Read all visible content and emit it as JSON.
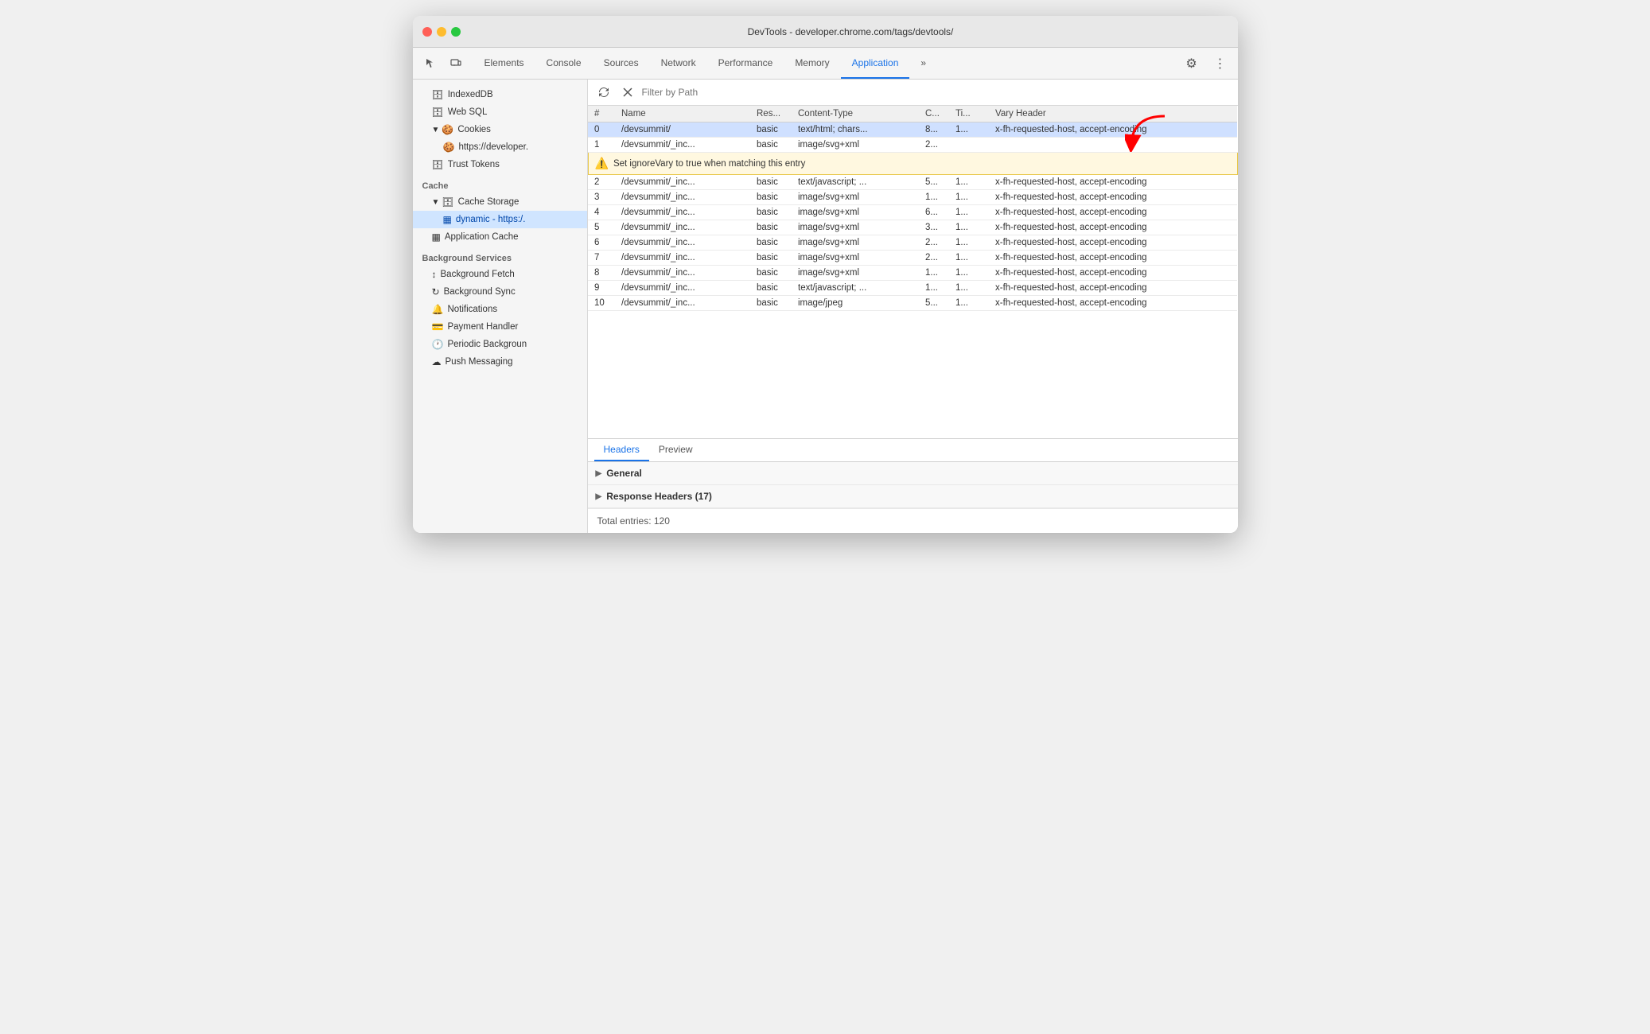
{
  "window": {
    "title": "DevTools - developer.chrome.com/tags/devtools/"
  },
  "toolbar": {
    "tabs": [
      {
        "id": "elements",
        "label": "Elements",
        "active": false
      },
      {
        "id": "console",
        "label": "Console",
        "active": false
      },
      {
        "id": "sources",
        "label": "Sources",
        "active": false
      },
      {
        "id": "network",
        "label": "Network",
        "active": false
      },
      {
        "id": "performance",
        "label": "Performance",
        "active": false
      },
      {
        "id": "memory",
        "label": "Memory",
        "active": false
      },
      {
        "id": "application",
        "label": "Application",
        "active": true
      }
    ],
    "more_label": "»",
    "settings_icon": "⚙",
    "menu_icon": "⋮"
  },
  "sidebar": {
    "sections": [
      {
        "items": [
          {
            "label": "IndexedDB",
            "icon": "🗄",
            "indent": 1,
            "expanded": false
          },
          {
            "label": "Web SQL",
            "icon": "🗄",
            "indent": 1,
            "expanded": false
          },
          {
            "label": "Cookies",
            "icon": "🍪",
            "indent": 1,
            "expanded": true,
            "hasTriangle": true
          },
          {
            "label": "https://developer.",
            "icon": "🍪",
            "indent": 2
          },
          {
            "label": "Trust Tokens",
            "icon": "🗄",
            "indent": 1
          }
        ]
      },
      {
        "name": "Cache",
        "items": [
          {
            "label": "Cache Storage",
            "icon": "🗄",
            "indent": 1,
            "expanded": true,
            "hasTriangle": true
          },
          {
            "label": "dynamic - https:/.",
            "icon": "▦",
            "indent": 2,
            "selected": true
          },
          {
            "label": "Application Cache",
            "icon": "▦",
            "indent": 1
          }
        ]
      },
      {
        "name": "Background Services",
        "items": [
          {
            "label": "Background Fetch",
            "icon": "↕",
            "indent": 1
          },
          {
            "label": "Background Sync",
            "icon": "↻",
            "indent": 1
          },
          {
            "label": "Notifications",
            "icon": "🔔",
            "indent": 1
          },
          {
            "label": "Payment Handler",
            "icon": "💳",
            "indent": 1
          },
          {
            "label": "Periodic Backgroun",
            "icon": "🕐",
            "indent": 1
          },
          {
            "label": "Push Messaging",
            "icon": "☁",
            "indent": 1
          }
        ]
      }
    ]
  },
  "filter": {
    "placeholder": "Filter by Path",
    "refresh_title": "Refresh",
    "clear_title": "Clear"
  },
  "table": {
    "columns": [
      "#",
      "Name",
      "Res...",
      "Content-Type",
      "C...",
      "Ti...",
      "Vary Header"
    ],
    "rows": [
      {
        "num": "0",
        "name": "/devsummit/",
        "res": "basic",
        "ct": "text/html; chars...",
        "c": "8...",
        "ti": "1...",
        "vary": "x-fh-requested-host, accept-encoding",
        "selected": true
      },
      {
        "num": "1",
        "name": "/devsummit/_inc...",
        "res": "basic",
        "ct": "image/svg+xml",
        "c": "2...",
        "ti": "",
        "vary": "",
        "tooltip": true
      },
      {
        "num": "2",
        "name": "/devsummit/_inc...",
        "res": "basic",
        "ct": "text/javascript; ...",
        "c": "5...",
        "ti": "1...",
        "vary": "x-fh-requested-host, accept-encoding"
      },
      {
        "num": "3",
        "name": "/devsummit/_inc...",
        "res": "basic",
        "ct": "image/svg+xml",
        "c": "1...",
        "ti": "1...",
        "vary": "x-fh-requested-host, accept-encoding"
      },
      {
        "num": "4",
        "name": "/devsummit/_inc...",
        "res": "basic",
        "ct": "image/svg+xml",
        "c": "6...",
        "ti": "1...",
        "vary": "x-fh-requested-host, accept-encoding"
      },
      {
        "num": "5",
        "name": "/devsummit/_inc...",
        "res": "basic",
        "ct": "image/svg+xml",
        "c": "3...",
        "ti": "1...",
        "vary": "x-fh-requested-host, accept-encoding"
      },
      {
        "num": "6",
        "name": "/devsummit/_inc...",
        "res": "basic",
        "ct": "image/svg+xml",
        "c": "2...",
        "ti": "1...",
        "vary": "x-fh-requested-host, accept-encoding"
      },
      {
        "num": "7",
        "name": "/devsummit/_inc...",
        "res": "basic",
        "ct": "image/svg+xml",
        "c": "2...",
        "ti": "1...",
        "vary": "x-fh-requested-host, accept-encoding"
      },
      {
        "num": "8",
        "name": "/devsummit/_inc...",
        "res": "basic",
        "ct": "image/svg+xml",
        "c": "1...",
        "ti": "1...",
        "vary": "x-fh-requested-host, accept-encoding"
      },
      {
        "num": "9",
        "name": "/devsummit/_inc...",
        "res": "basic",
        "ct": "text/javascript; ...",
        "c": "1...",
        "ti": "1...",
        "vary": "x-fh-requested-host, accept-encoding"
      },
      {
        "num": "10",
        "name": "/devsummit/_inc...",
        "res": "basic",
        "ct": "image/jpeg",
        "c": "5...",
        "ti": "1...",
        "vary": "x-fh-requested-host, accept-encoding"
      }
    ],
    "tooltip_text": "Set ignoreVary to true when matching this entry"
  },
  "bottom_panel": {
    "tabs": [
      {
        "label": "Headers",
        "active": true
      },
      {
        "label": "Preview",
        "active": false
      }
    ],
    "sections": [
      {
        "label": "General",
        "expanded": false
      },
      {
        "label": "Response Headers (17)",
        "expanded": false
      }
    ],
    "total_entries": "Total entries: 120"
  }
}
